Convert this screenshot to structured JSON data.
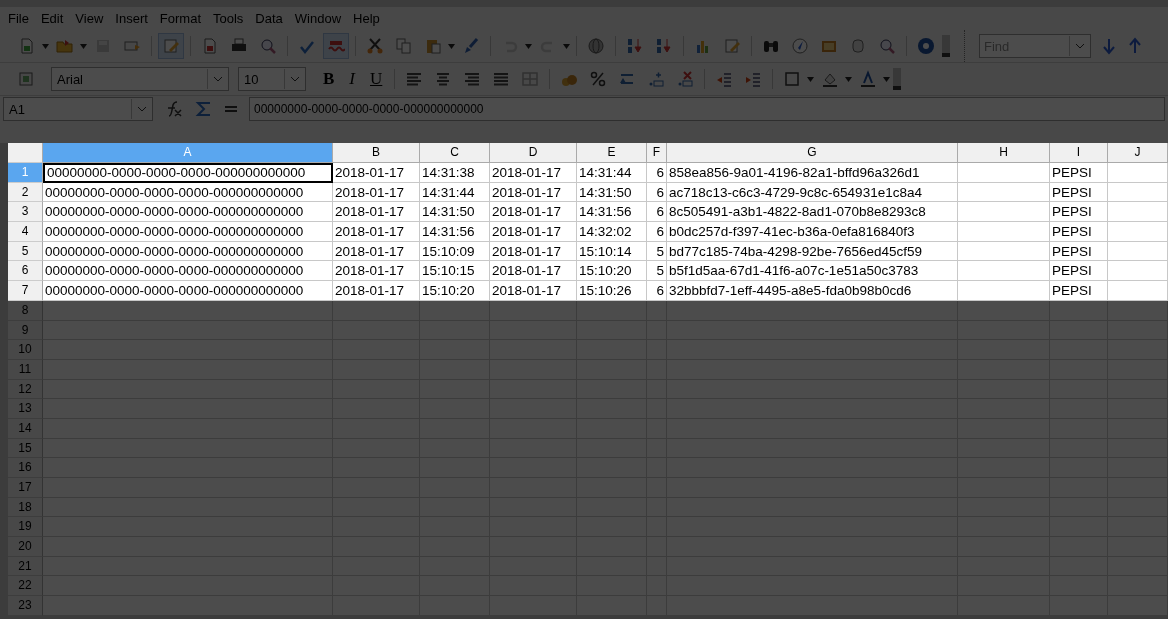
{
  "menu": [
    {
      "label": "File"
    },
    {
      "label": "Edit"
    },
    {
      "label": "View"
    },
    {
      "label": "Insert"
    },
    {
      "label": "Format"
    },
    {
      "label": "Tools"
    },
    {
      "label": "Data"
    },
    {
      "label": "Window"
    },
    {
      "label": "Help"
    }
  ],
  "toolbar": [
    {
      "kind": "new",
      "menu": true,
      "disabled": false,
      "selected": false
    },
    {
      "kind": "open",
      "menu": true,
      "disabled": false,
      "selected": false
    },
    {
      "kind": "save",
      "menu": false,
      "disabled": true,
      "selected": false
    },
    {
      "kind": "email",
      "menu": false,
      "disabled": false,
      "selected": false
    },
    {
      "kind": "edit",
      "menu": false,
      "disabled": false,
      "selected": true
    },
    {
      "kind": "pdf",
      "menu": false,
      "disabled": false,
      "selected": false
    },
    {
      "kind": "print",
      "menu": false,
      "disabled": false,
      "selected": false
    },
    {
      "kind": "preview",
      "menu": false,
      "disabled": false,
      "selected": false
    },
    {
      "kind": "spell",
      "menu": false,
      "disabled": false,
      "selected": false
    },
    {
      "kind": "autospell",
      "menu": false,
      "disabled": false,
      "selected": true
    },
    {
      "kind": "cut",
      "menu": false,
      "disabled": false,
      "selected": false
    },
    {
      "kind": "copy",
      "menu": false,
      "disabled": false,
      "selected": false
    },
    {
      "kind": "paste",
      "menu": true,
      "disabled": false,
      "selected": false
    },
    {
      "kind": "brush",
      "menu": false,
      "disabled": false,
      "selected": false
    },
    {
      "kind": "undo",
      "menu": true,
      "disabled": true,
      "selected": false
    },
    {
      "kind": "redo",
      "menu": true,
      "disabled": true,
      "selected": false
    },
    {
      "kind": "globe",
      "menu": false,
      "disabled": false,
      "selected": false
    },
    {
      "kind": "sort-asc",
      "menu": false,
      "disabled": false,
      "selected": false
    },
    {
      "kind": "sort-desc",
      "menu": false,
      "disabled": false,
      "selected": false
    },
    {
      "kind": "chart",
      "menu": false,
      "disabled": false,
      "selected": false
    },
    {
      "kind": "draw",
      "menu": false,
      "disabled": false,
      "selected": false
    },
    {
      "kind": "binoculars",
      "menu": false,
      "disabled": false,
      "selected": false
    },
    {
      "kind": "compass",
      "menu": false,
      "disabled": false,
      "selected": false
    },
    {
      "kind": "gallery",
      "menu": false,
      "disabled": false,
      "selected": false
    },
    {
      "kind": "database",
      "menu": false,
      "disabled": false,
      "selected": false
    },
    {
      "kind": "zoom",
      "menu": false,
      "disabled": false,
      "selected": false
    },
    {
      "kind": "help",
      "menu": false,
      "disabled": false,
      "selected": false
    }
  ],
  "find": {
    "placeholder": "Find"
  },
  "format_bar": {
    "font": "Arial",
    "size": "10",
    "styles": [
      {
        "kind": "bold",
        "label": "B"
      },
      {
        "kind": "italic",
        "label": "I"
      },
      {
        "kind": "underline",
        "label": "U"
      }
    ],
    "tools": [
      {
        "kind": "align-left",
        "menu": false,
        "disabled": false
      },
      {
        "kind": "align-center",
        "menu": false,
        "disabled": false
      },
      {
        "kind": "align-right",
        "menu": false,
        "disabled": false
      },
      {
        "kind": "justify",
        "menu": false,
        "disabled": false
      },
      {
        "kind": "merge",
        "menu": false,
        "disabled": true
      },
      {
        "kind": "currency",
        "menu": false,
        "disabled": false
      },
      {
        "kind": "percent",
        "menu": false,
        "disabled": false
      },
      {
        "kind": "standard",
        "menu": false,
        "disabled": false
      },
      {
        "kind": "add-decimal",
        "menu": false,
        "disabled": false
      },
      {
        "kind": "delete-decimal",
        "menu": false,
        "disabled": false
      },
      {
        "kind": "outdent",
        "menu": false,
        "disabled": false
      },
      {
        "kind": "indent",
        "menu": false,
        "disabled": false
      },
      {
        "kind": "border",
        "menu": true,
        "disabled": false
      },
      {
        "kind": "background",
        "menu": true,
        "disabled": false
      },
      {
        "kind": "font-color",
        "menu": true,
        "disabled": false
      }
    ]
  },
  "formula_bar": {
    "cell": "A1",
    "content": "00000000-0000-0000-0000-000000000000"
  },
  "sheet": {
    "columns": [
      {
        "label": "A",
        "kind": "text",
        "selected": true
      },
      {
        "label": "B",
        "kind": "text",
        "selected": false
      },
      {
        "label": "C",
        "kind": "text",
        "selected": false
      },
      {
        "label": "D",
        "kind": "text",
        "selected": false
      },
      {
        "label": "E",
        "kind": "text",
        "selected": false
      },
      {
        "label": "F",
        "kind": "number",
        "selected": false
      },
      {
        "label": "G",
        "kind": "text",
        "selected": false
      },
      {
        "label": "H",
        "kind": "text",
        "selected": false
      },
      {
        "label": "I",
        "kind": "text",
        "selected": false
      },
      {
        "label": "J",
        "kind": "text",
        "selected": false
      }
    ],
    "rows": [
      {
        "number": "1",
        "selected": true,
        "cells": {
          "A": "00000000-0000-0000-0000-000000000000",
          "B": "2018-01-17",
          "C": "14:31:38",
          "D": "2018-01-17",
          "E": "14:31:44",
          "F": "6",
          "G": "858ea856-9a01-4196-82a1-bffd96a326d1",
          "I": "PEPSI"
        }
      },
      {
        "number": "2",
        "selected": false,
        "cells": {
          "A": "00000000-0000-0000-0000-000000000000",
          "B": "2018-01-17",
          "C": "14:31:44",
          "D": "2018-01-17",
          "E": "14:31:50",
          "F": "6",
          "G": "ac718c13-c6c3-4729-9c8c-654931e1c8a4",
          "I": "PEPSI"
        }
      },
      {
        "number": "3",
        "selected": false,
        "cells": {
          "A": "00000000-0000-0000-0000-000000000000",
          "B": "2018-01-17",
          "C": "14:31:50",
          "D": "2018-01-17",
          "E": "14:31:56",
          "F": "6",
          "G": "8c505491-a3b1-4822-8ad1-070b8e8293c8",
          "I": "PEPSI"
        }
      },
      {
        "number": "4",
        "selected": false,
        "cells": {
          "A": "00000000-0000-0000-0000-000000000000",
          "B": "2018-01-17",
          "C": "14:31:56",
          "D": "2018-01-17",
          "E": "14:32:02",
          "F": "6",
          "G": "b0dc257d-f397-41ec-b36a-0efa816840f3",
          "I": "PEPSI"
        }
      },
      {
        "number": "5",
        "selected": false,
        "cells": {
          "A": "00000000-0000-0000-0000-000000000000",
          "B": "2018-01-17",
          "C": "15:10:09",
          "D": "2018-01-17",
          "E": "15:10:14",
          "F": "5",
          "G": "bd77c185-74ba-4298-92be-7656ed45cf59",
          "I": "PEPSI"
        }
      },
      {
        "number": "6",
        "selected": false,
        "cells": {
          "A": "00000000-0000-0000-0000-000000000000",
          "B": "2018-01-17",
          "C": "15:10:15",
          "D": "2018-01-17",
          "E": "15:10:20",
          "F": "5",
          "G": "b5f1d5aa-67d1-41f6-a07c-1e51a50c3783",
          "I": "PEPSI"
        }
      },
      {
        "number": "7",
        "selected": false,
        "cells": {
          "A": "00000000-0000-0000-0000-000000000000",
          "B": "2018-01-17",
          "C": "15:10:20",
          "D": "2018-01-17",
          "E": "15:10:26",
          "F": "6",
          "G": "32bbbfd7-1eff-4495-a8e5-fda0b98b0cd6",
          "I": "PEPSI"
        }
      }
    ],
    "empty_rows": [
      "8",
      "9",
      "10",
      "11",
      "12",
      "13",
      "14",
      "15",
      "16",
      "17",
      "18",
      "19",
      "20",
      "21",
      "22",
      "23"
    ]
  }
}
